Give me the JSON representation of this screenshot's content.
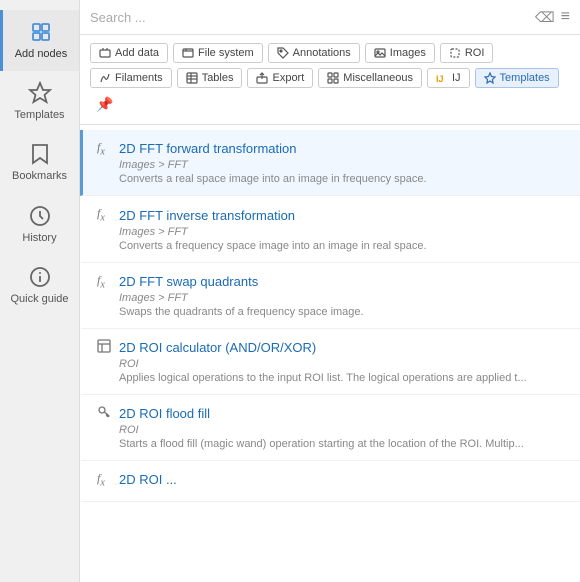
{
  "sidebar": {
    "items": [
      {
        "id": "add-nodes",
        "label": "Add nodes",
        "active": true
      },
      {
        "id": "templates",
        "label": "Templates",
        "active": false
      },
      {
        "id": "bookmarks",
        "label": "Bookmarks",
        "active": false
      },
      {
        "id": "history",
        "label": "History",
        "active": false
      },
      {
        "id": "quick-guide",
        "label": "Quick guide",
        "active": false
      }
    ]
  },
  "search": {
    "placeholder": "Search ...",
    "clear_symbol": "⌫",
    "menu_symbol": "≡"
  },
  "filters": [
    {
      "id": "add-data",
      "label": "Add data",
      "icon": "data-icon",
      "active": false
    },
    {
      "id": "file-system",
      "label": "File system",
      "icon": "file-icon",
      "active": false
    },
    {
      "id": "annotations",
      "label": "Annotations",
      "icon": "tag-icon",
      "active": false
    },
    {
      "id": "images",
      "label": "Images",
      "icon": "image-icon",
      "active": false
    },
    {
      "id": "roi",
      "label": "ROI",
      "icon": "roi-icon",
      "active": false
    },
    {
      "id": "filaments",
      "label": "Filaments",
      "icon": "filament-icon",
      "active": false
    },
    {
      "id": "tables",
      "label": "Tables",
      "icon": "table-icon",
      "active": false
    },
    {
      "id": "export",
      "label": "Export",
      "icon": "export-icon",
      "active": false
    },
    {
      "id": "miscellaneous",
      "label": "Miscellaneous",
      "icon": "misc-icon",
      "active": false
    },
    {
      "id": "ij",
      "label": "IJ",
      "icon": "ij-icon",
      "active": false
    },
    {
      "id": "templates",
      "label": "Templates",
      "icon": "star-icon",
      "active": true
    }
  ],
  "results": [
    {
      "id": "r1",
      "title": "2D FFT forward transformation",
      "category": "Images > FFT",
      "description": "Converts a real space image into an image in frequency space.",
      "selected": true
    },
    {
      "id": "r2",
      "title": "2D FFT inverse transformation",
      "category": "Images > FFT",
      "description": "Converts a frequency space image into an image in real space.",
      "selected": false
    },
    {
      "id": "r3",
      "title": "2D FFT swap quadrants",
      "category": "Images > FFT",
      "description": "Swaps the quadrants of a frequency space image.",
      "selected": false
    },
    {
      "id": "r4",
      "title": "2D ROI calculator (AND/OR/XOR)",
      "category": "ROI",
      "description": "Applies logical operations to the input ROI list. The logical operations are applied t...",
      "selected": false
    },
    {
      "id": "r5",
      "title": "2D ROI flood fill",
      "category": "ROI",
      "description": "Starts a flood fill (magic wand) operation starting at the location of the ROI. Multip...",
      "selected": false
    },
    {
      "id": "r6",
      "title": "2D ROI ...",
      "category": "",
      "description": "",
      "selected": false,
      "partial": true
    }
  ]
}
